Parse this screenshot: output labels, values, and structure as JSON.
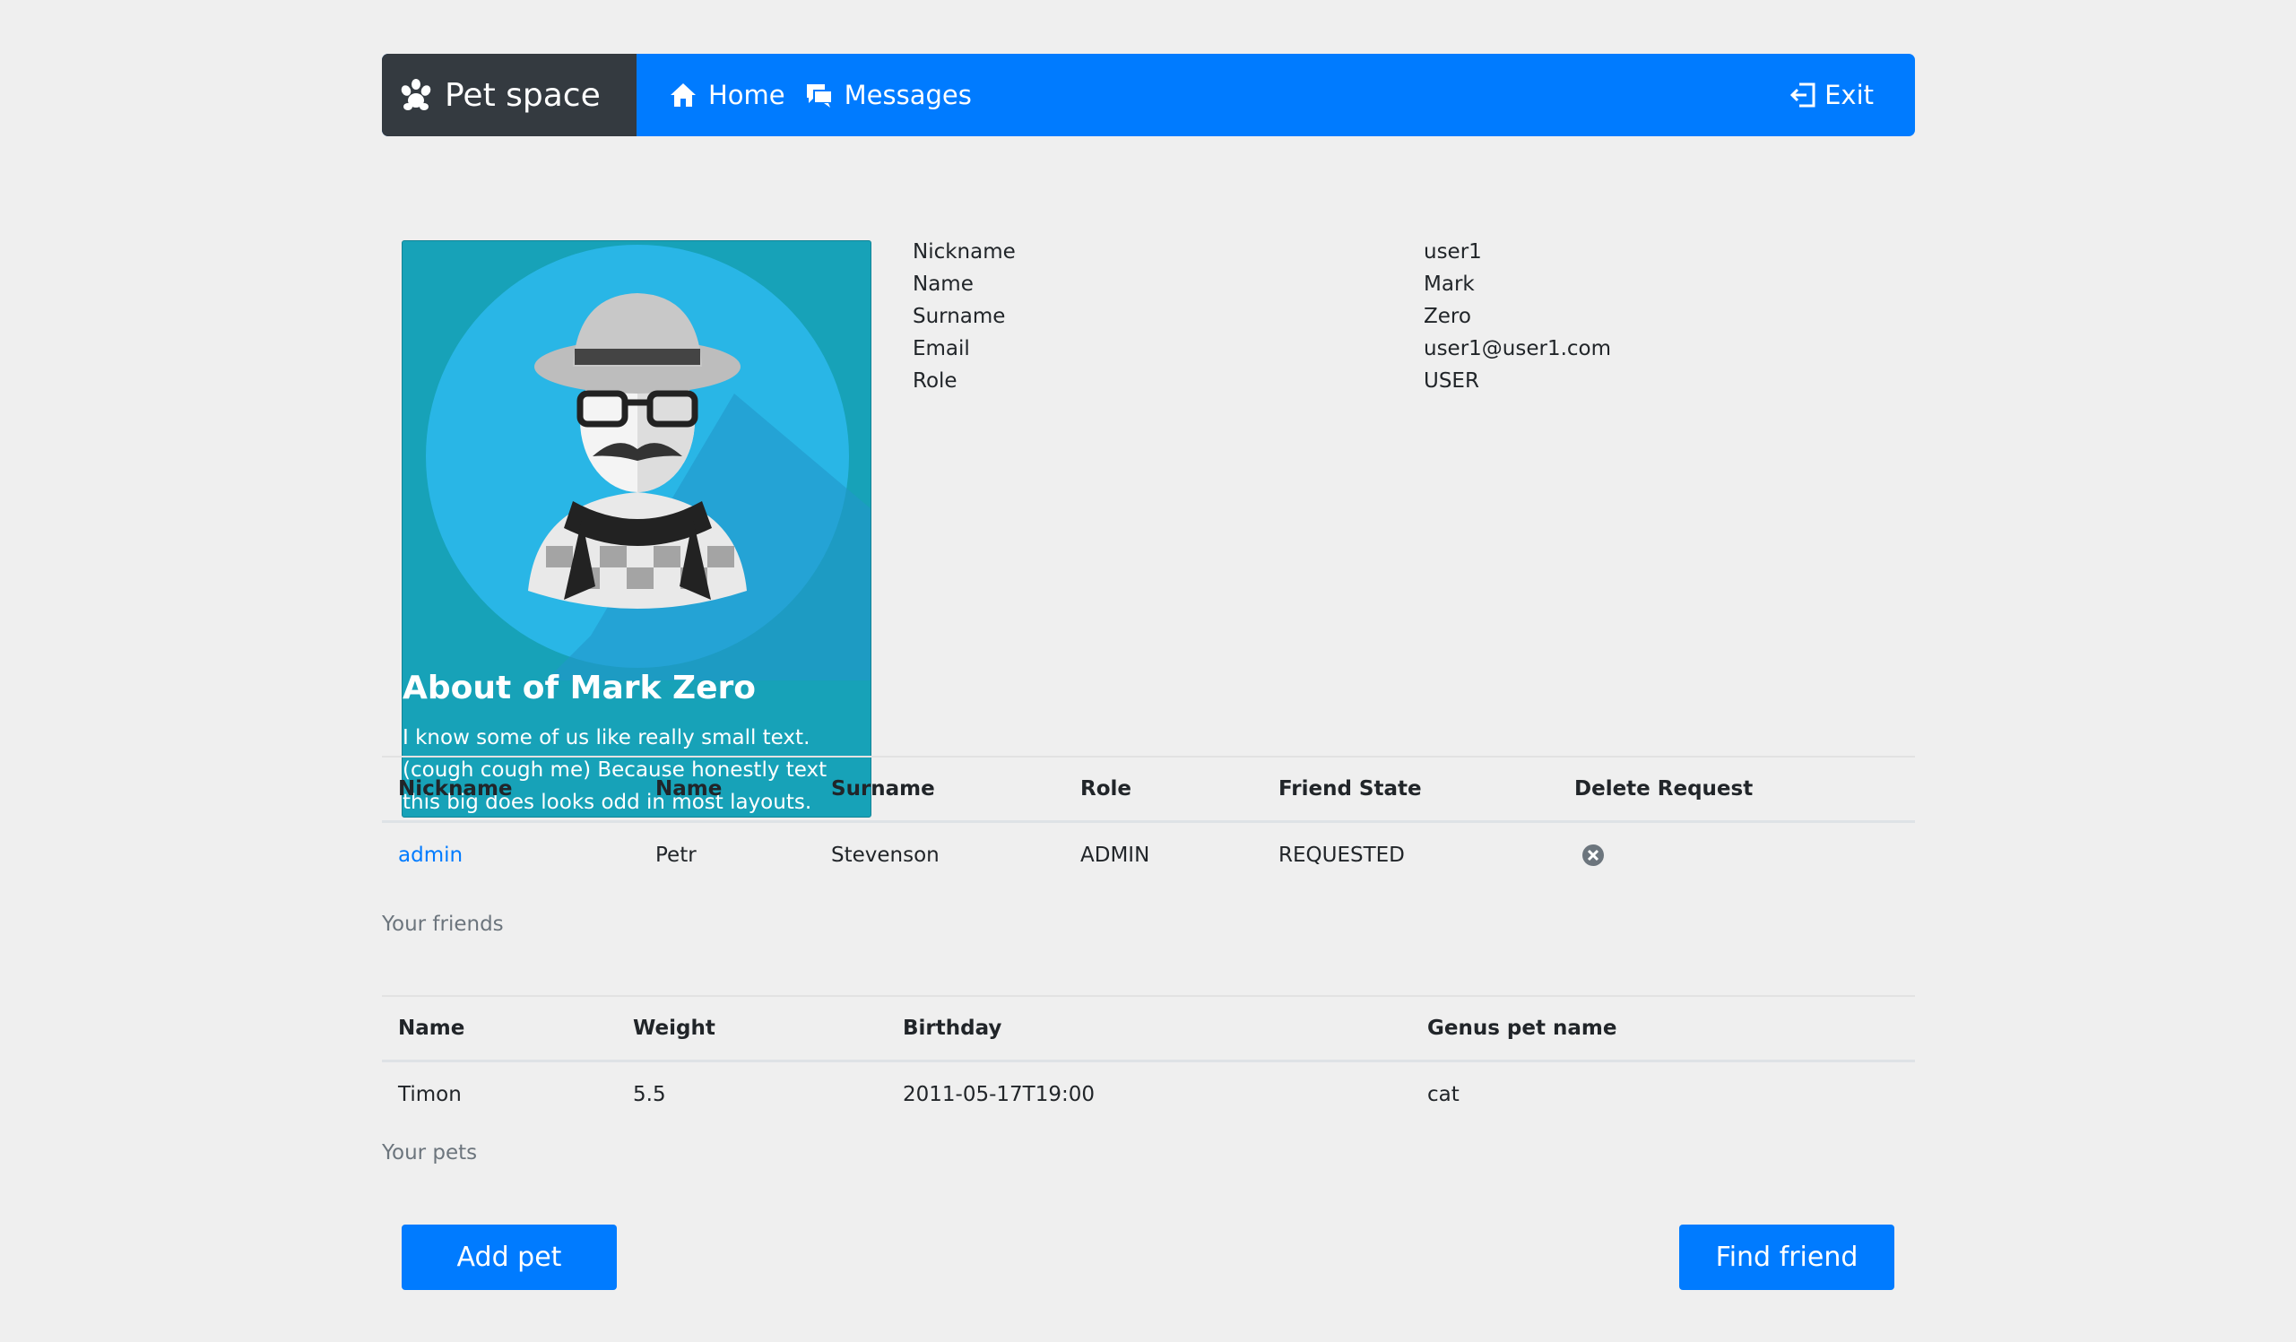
{
  "navbar": {
    "brand": "Pet space",
    "home_label": "Home",
    "messages_label": "Messages",
    "exit_label": "Exit"
  },
  "profile": {
    "card_title": "About of Mark Zero",
    "card_text": "I know some of us like really small text. (cough cough me) Because honestly text this big does looks odd in most layouts.",
    "fields": [
      {
        "key": "Nickname",
        "value": "user1"
      },
      {
        "key": "Name",
        "value": "Mark"
      },
      {
        "key": "Surname",
        "value": "Zero"
      },
      {
        "key": "Email",
        "value": "user1@user1.com"
      },
      {
        "key": "Role",
        "value": "USER"
      }
    ]
  },
  "friends_table": {
    "headers": [
      "Nickname",
      "Name",
      "Surname",
      "Role",
      "Friend State",
      "Delete Request"
    ],
    "rows": [
      {
        "nickname": "admin",
        "name": "Petr",
        "surname": "Stevenson",
        "role": "ADMIN",
        "state": "REQUESTED"
      }
    ],
    "caption": "Your friends"
  },
  "pets_table": {
    "headers": [
      "Name",
      "Weight",
      "Birthday",
      "Genus pet name"
    ],
    "rows": [
      {
        "name": "Timon",
        "weight": "5.5",
        "birthday": "2011-05-17T19:00",
        "genus": "cat"
      }
    ],
    "caption": "Your pets"
  },
  "buttons": {
    "add_pet": "Add pet",
    "find_friend": "Find friend"
  },
  "colors": {
    "primary": "#007bff",
    "dark": "#343a40",
    "card": "#17a2b8"
  }
}
